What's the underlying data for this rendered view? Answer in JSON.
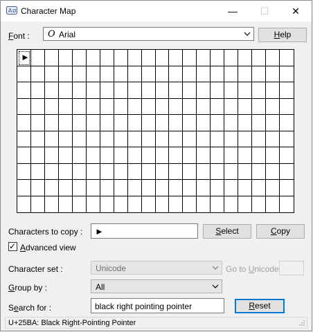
{
  "window": {
    "title": "Character Map",
    "minimize_glyph": "—",
    "maximize_glyph": "☐",
    "close_glyph": "✕"
  },
  "font": {
    "label_underlined": "F",
    "label_rest": "ont :",
    "value": "Arial",
    "font_type_glyph": "O"
  },
  "help_button": {
    "u": "H",
    "rest": "elp"
  },
  "grid": {
    "columns": 20,
    "rows": 10,
    "selected_glyph": "►"
  },
  "copy_row": {
    "label": "Characters to copy :",
    "value": "►",
    "select": {
      "u": "S",
      "rest": "elect"
    },
    "copy": {
      "u": "C",
      "rest": "opy"
    }
  },
  "advanced_view": {
    "u": "A",
    "rest": "dvanced view",
    "checked": true,
    "check_glyph": "✓"
  },
  "character_set": {
    "label": "Character set :",
    "value": "Unicode"
  },
  "go_to_unicode": {
    "pre": "Go to ",
    "u": "U",
    "rest": "nicode :"
  },
  "group_by": {
    "u": "G",
    "rest": "roup by :",
    "value": "All"
  },
  "search": {
    "u": "e",
    "pre": "S",
    "rest": "arch for :",
    "value": "black right pointing pointer",
    "reset": {
      "u": "R",
      "rest": "eset"
    }
  },
  "status": "U+25BA: Black Right-Pointing Pointer"
}
